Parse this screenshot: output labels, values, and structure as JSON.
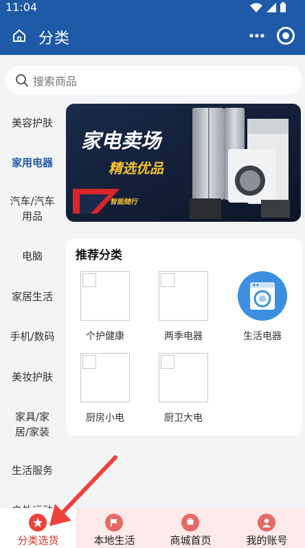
{
  "status_bar": {
    "time": "11:04"
  },
  "header": {
    "title": "分类"
  },
  "search": {
    "placeholder": "搜索商品"
  },
  "sidebar": {
    "items": [
      {
        "label": "美容护肤"
      },
      {
        "label": "家用电器"
      },
      {
        "label": "汽车/汽车用品"
      },
      {
        "label": "电脑"
      },
      {
        "label": "家居生活"
      },
      {
        "label": "手机/数码"
      },
      {
        "label": "美妆护肤"
      },
      {
        "label": "家具/家居/家装"
      },
      {
        "label": "生活服务"
      },
      {
        "label": "户外运动"
      }
    ],
    "active_index": 1
  },
  "banner": {
    "title": "家电卖场",
    "subtitle": "精选优品",
    "tag": "智能随行"
  },
  "recommend": {
    "title": "推荐分类",
    "items": [
      {
        "label": "个护健康"
      },
      {
        "label": "两季电器"
      },
      {
        "label": "生活电器"
      },
      {
        "label": "厨房小电"
      },
      {
        "label": "厨卫大电"
      }
    ]
  },
  "bottom_nav": {
    "items": [
      {
        "label": "分类选货",
        "icon": "star-icon"
      },
      {
        "label": "本地生活",
        "icon": "flag-icon"
      },
      {
        "label": "商城首页",
        "icon": "cart-icon"
      },
      {
        "label": "我的账号",
        "icon": "user-icon"
      }
    ],
    "active_index": 0
  },
  "colors": {
    "primary": "#1e5aa8",
    "accent": "#d9302b",
    "nav_bg": "#fce9e9"
  }
}
